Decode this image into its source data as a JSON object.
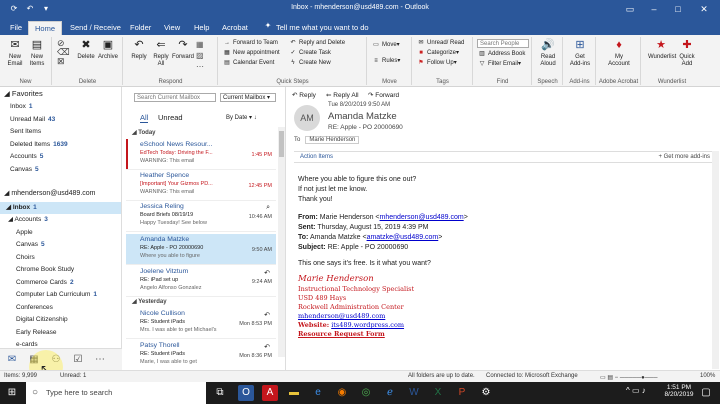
{
  "window": {
    "title": "Inbox - mhenderson@usd489.com - Outlook"
  },
  "tabs": [
    "File",
    "Home",
    "Send / Receive",
    "Folder",
    "View",
    "Help",
    "Acrobat"
  ],
  "tell_me": "Tell me what you want to do",
  "ribbon": {
    "new_email": "New Email",
    "new_items": "New Items",
    "group_new": "New",
    "delete": "Delete",
    "archive": "Archive",
    "group_delete": "Delete",
    "reply": "Reply",
    "reply_all": "Reply All",
    "forward": "Forward",
    "group_respond": "Respond",
    "quick_steps": [
      "Forward to Team",
      "New appointment",
      "Calendar Event",
      "Reply and Delete",
      "Create Task",
      "Create New"
    ],
    "group_quick": "Quick Steps",
    "move": "Move",
    "rules": "Rules",
    "group_move": "Move",
    "unread_read": "Unread/ Read",
    "categorize": "Categorize",
    "follow_up": "Follow Up",
    "group_tags": "Tags",
    "search_people": "Search People",
    "address_book": "Address Book",
    "filter_email": "Filter Email",
    "group_find": "Find",
    "read_aloud": "Read Aloud",
    "group_speech": "Speech",
    "get_addins": "Get Add-ins",
    "group_addins": "Add-ins",
    "my_account": "My Account",
    "group_acrobat": "Adobe Acrobat",
    "wunderlist": "Wunderlist",
    "quick_add": "Quick Add",
    "group_wunderlist": "Wunderlist"
  },
  "folders": {
    "favorites_label": "Favorites",
    "favorites": [
      {
        "name": "Inbox",
        "count": "1"
      },
      {
        "name": "Unread Mail",
        "count": "43"
      },
      {
        "name": "Sent Items",
        "count": ""
      },
      {
        "name": "Deleted Items",
        "count": "1639"
      },
      {
        "name": "Accounts",
        "count": "5"
      },
      {
        "name": "Canvas",
        "count": "5"
      }
    ],
    "account": "mhenderson@usd489.com",
    "inbox": {
      "name": "Inbox",
      "count": "1"
    },
    "subfolders": [
      {
        "name": "Accounts",
        "count": "3"
      },
      {
        "name": "Apple",
        "count": ""
      },
      {
        "name": "Canvas",
        "count": "5"
      },
      {
        "name": "Choirs",
        "count": ""
      },
      {
        "name": "Chrome Book Study",
        "count": ""
      },
      {
        "name": "Commerce Cards",
        "count": "2"
      },
      {
        "name": "Computer Lab Curriculum",
        "count": "1"
      },
      {
        "name": "Conferences",
        "count": ""
      },
      {
        "name": "Digital Citizenship",
        "count": ""
      },
      {
        "name": "Early Release",
        "count": ""
      },
      {
        "name": "e-cards",
        "count": ""
      }
    ]
  },
  "msglist": {
    "search_placeholder": "Search Current Mailbox",
    "scope": "Current Mailbox",
    "filter_all": "All",
    "filter_unread": "Unread",
    "sort": "By Date",
    "today": "Today",
    "yesterday": "Yesterday",
    "messages": [
      {
        "sender": "eSchool News Resour...",
        "subject": "EdTech Today: Driving the F...",
        "preview": "WARNING: This email",
        "time": "1:45 PM"
      },
      {
        "sender": "Heather Spence",
        "subject": "[Important] Your Gizmos PD...",
        "preview": "WARNING: This email",
        "time": "12:45 PM"
      },
      {
        "sender": "Jessica Reling",
        "subject": "Board Briefs 08/19/19",
        "preview": "Happy Tuesday!  See below",
        "time": "10:46 AM"
      },
      {
        "sender": "Amanda Matzke",
        "subject": "RE: Apple - PO 20000690",
        "preview": "Where you able to figure",
        "time": "9:50 AM"
      },
      {
        "sender": "Joelene Vitztum",
        "subject": "RE: iPad set up",
        "preview": "Angelo Alfonso Gonzalez",
        "time": "9:24 AM"
      },
      {
        "sender": "Nicole Cullison",
        "subject": "RE: Student iPads",
        "preview": "Mrs. I was able to get Michael's",
        "time": "Mon 8:53 PM"
      },
      {
        "sender": "Patsy Thorell",
        "subject": "RE: Student iPads",
        "preview": "Marie, I was able to get",
        "time": "Mon 8:36 PM"
      }
    ]
  },
  "reading": {
    "reply": "Reply",
    "reply_all": "Reply All",
    "forward": "Forward",
    "avatar_initials": "AM",
    "date": "Tue 8/20/2019 9:50 AM",
    "from_name": "Amanda Matzke",
    "subject": "RE: Apple - PO 20000690",
    "to_label": "To",
    "to_name": "Marie Henderson",
    "action_items": "Action Items",
    "get_more_addins": "+ Get more add-ins",
    "body_lines": [
      "Where you able to figure this one out?",
      "If not just let me know.",
      "Thank you!"
    ],
    "quoted": {
      "from_label": "From:",
      "from_value": "Marie Henderson <",
      "from_email": "mhenderson@usd489.com",
      "from_end": ">",
      "sent_label": "Sent:",
      "sent_value": "Thursday, August 15, 2019 4:39 PM",
      "to_label": "To:",
      "to_value": "Amanda Matzke <",
      "to_email": "amatzke@usd489.com",
      "to_end": ">",
      "subject_label": "Subject:",
      "subject_value": "RE: Apple - PO 20000690"
    },
    "question": "This one says it's free.  Is it what you want?",
    "signature": {
      "name": "Marie Henderson",
      "title": "Instructional Technology Specialist",
      "org": "USD 489 Hays",
      "building": "Rockwell Administration Center",
      "email": "mhenderson@usd489.com",
      "website_label": "Website:",
      "website": "its489.wordpress.com",
      "form": "Resource Request Form"
    }
  },
  "status": {
    "items": "Items: 9,999",
    "unread": "Unread: 1",
    "sync": "All folders are up to date.",
    "connection": "Connected to: Microsoft Exchange",
    "zoom": "100%"
  },
  "taskbar": {
    "search": "Type here to search",
    "time": "1:51 PM",
    "date": "8/20/2019"
  },
  "colors": {
    "accent": "#2b579a",
    "unread": "#c4161c",
    "selected": "#cde6f7"
  }
}
